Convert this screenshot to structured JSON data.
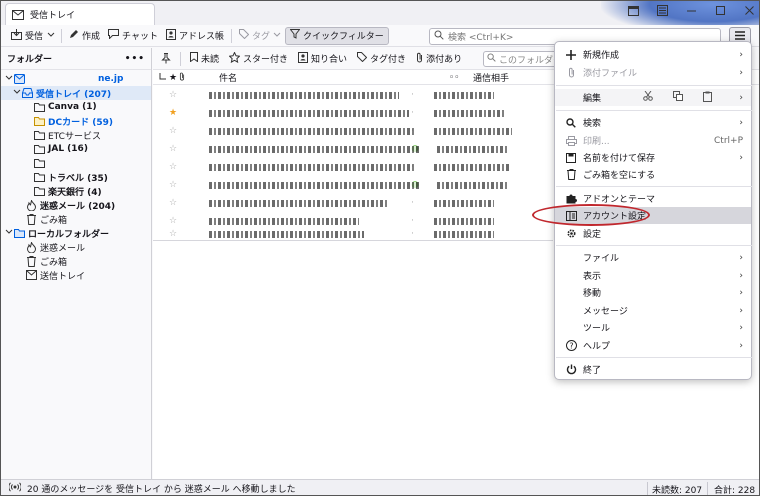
{
  "window": {
    "tab_title": "受信トレイ"
  },
  "toolbar": {
    "get_messages": "受信",
    "write": "作成",
    "chat": "チャット",
    "address_book": "アドレス帳",
    "tag": "タグ",
    "quick_filter": "クイックフィルター",
    "search_placeholder": "検索 <Ctrl+K>"
  },
  "folders": {
    "header": "フォルダー",
    "account": "ne.jp",
    "items": [
      {
        "label": "受信トレイ (207)"
      },
      {
        "label": "Canva (1)"
      },
      {
        "label": "DCカード (59)"
      },
      {
        "label": "ETCサービス"
      },
      {
        "label": "JAL (16)"
      },
      {
        "label": ""
      },
      {
        "label": "トラベル (35)"
      },
      {
        "label": "楽天銀行 (4)"
      },
      {
        "label": "迷惑メール (204)"
      },
      {
        "label": "ごみ箱"
      },
      {
        "label": "ローカルフォルダー"
      },
      {
        "label": "迷惑メール"
      },
      {
        "label": "ごみ箱"
      },
      {
        "label": "送信トレイ"
      }
    ]
  },
  "quickfilter": {
    "unread": "未読",
    "starred": "スター付き",
    "contact": "知り合い",
    "tagged": "タグ付き",
    "attachment": "添付あり",
    "filter_placeholder": "このフォルダー"
  },
  "columns": {
    "subject": "件名",
    "correspondent": "通信相手"
  },
  "menu": {
    "new": "新規作成",
    "attach": "添付ファイル",
    "edit": "編集",
    "find": "検索",
    "print": "印刷...",
    "print_shortcut": "Ctrl+P",
    "save_as": "名前を付けて保存",
    "empty_trash": "ごみ箱を空にする",
    "addons": "アドオンとテーマ",
    "account_settings": "アカウント設定",
    "settings": "設定",
    "file": "ファイル",
    "view": "表示",
    "go": "移動",
    "message": "メッセージ",
    "tools": "ツール",
    "help": "ヘルプ",
    "quit": "終了"
  },
  "status": {
    "message": "20 通のメッセージを 受信トレイ から 迷惑メール へ移動しました",
    "unread": "未読数: 207",
    "total": "合計: 228"
  },
  "colors": {
    "accent": "#0060df",
    "annotation": "#c0272d",
    "selection": "#dfe9f7"
  }
}
